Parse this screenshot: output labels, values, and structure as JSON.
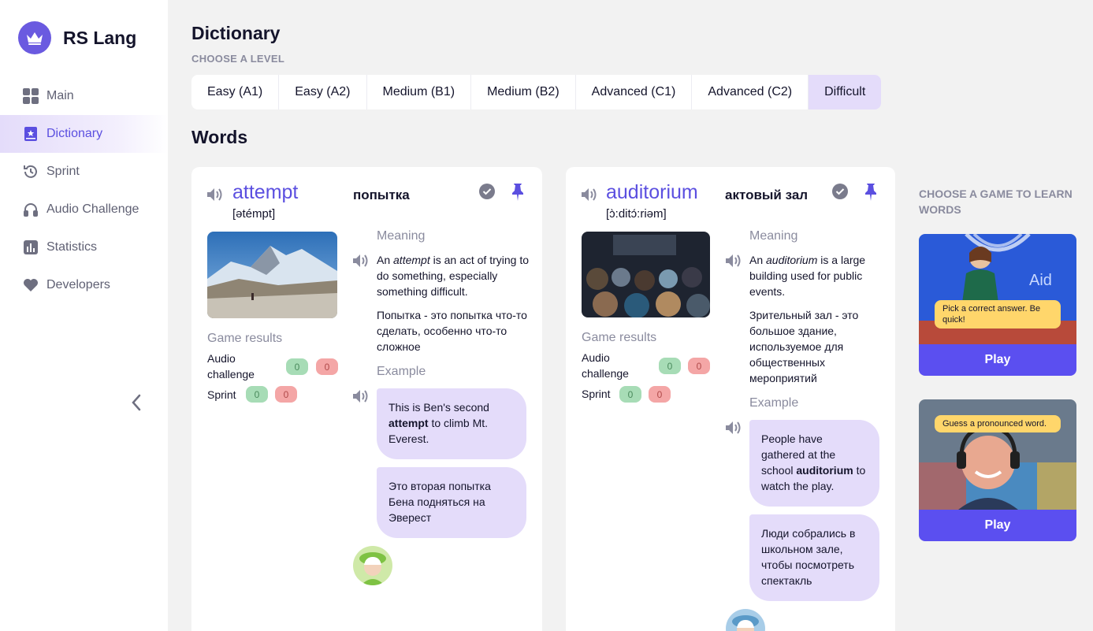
{
  "app": {
    "name": "RS Lang"
  },
  "sidebar": {
    "items": [
      {
        "label": "Main",
        "icon": "grid-icon"
      },
      {
        "label": "Dictionary",
        "icon": "book-star-icon",
        "active": true
      },
      {
        "label": "Sprint",
        "icon": "history-icon"
      },
      {
        "label": "Audio Challenge",
        "icon": "headphones-icon"
      },
      {
        "label": "Statistics",
        "icon": "bar-chart-icon"
      },
      {
        "label": "Developers",
        "icon": "heart-icon"
      }
    ]
  },
  "header": {
    "title": "Dictionary",
    "level_caption": "CHOOSE A LEVEL"
  },
  "levels": [
    "Easy (A1)",
    "Easy (A2)",
    "Medium (B1)",
    "Medium (B2)",
    "Advanced (C1)",
    "Advanced (C2)",
    "Difficult"
  ],
  "active_level": "Difficult",
  "words_title": "Words",
  "cards": [
    {
      "word": "attempt",
      "translation": "попытка",
      "transcription": "[ətémpt]",
      "meaning_label": "Meaning",
      "meaning_pre": "An ",
      "meaning_word": "attempt",
      "meaning_post": " is an act of trying to do something, especially something difficult.",
      "meaning_ru": "Попытка - это попытка что-то сделать, особенно что-то сложное",
      "results_label": "Game results",
      "audio_label": "Audio challenge",
      "audio_right": "0",
      "audio_wrong": "0",
      "sprint_label": "Sprint",
      "sprint_right": "0",
      "sprint_wrong": "0",
      "example_label": "Example",
      "example_pre": "This is Ben's second ",
      "example_word": "attempt",
      "example_post": " to climb Mt. Everest.",
      "example_ru": "Это вторая попытка Бена подняться на Эверест"
    },
    {
      "word": "auditorium",
      "translation": "актовый зал",
      "transcription": "[ɔ̀:ditɔ́:riəm]",
      "meaning_label": "Meaning",
      "meaning_pre": "An ",
      "meaning_word": "auditorium",
      "meaning_post": " is a large building used for public events.",
      "meaning_ru": "Зрительный зал - это большое здание, используемое для общественных мероприятий",
      "results_label": "Game results",
      "audio_label": "Audio challenge",
      "audio_right": "0",
      "audio_wrong": "0",
      "sprint_label": "Sprint",
      "sprint_right": "0",
      "sprint_wrong": "0",
      "example_label": "Example",
      "example_pre": "People have gathered at the school ",
      "example_word": "auditorium",
      "example_post": " to watch the play.",
      "example_ru": "Люди собрались в школьном зале, чтобы посмотреть спектакль"
    }
  ],
  "games": {
    "caption": "CHOOSE A GAME TO LEARN WORDS",
    "items": [
      {
        "tip": "Pick a correct answer. Be quick!",
        "play_label": "Play",
        "image_text": "Aid"
      },
      {
        "tip": "Guess a pronounced word.",
        "play_label": "Play"
      }
    ]
  },
  "colors": {
    "accent": "#5b4fe0",
    "bubble": "#e4dcfa",
    "tip": "#ffd66b",
    "play": "#5b4ff0"
  }
}
